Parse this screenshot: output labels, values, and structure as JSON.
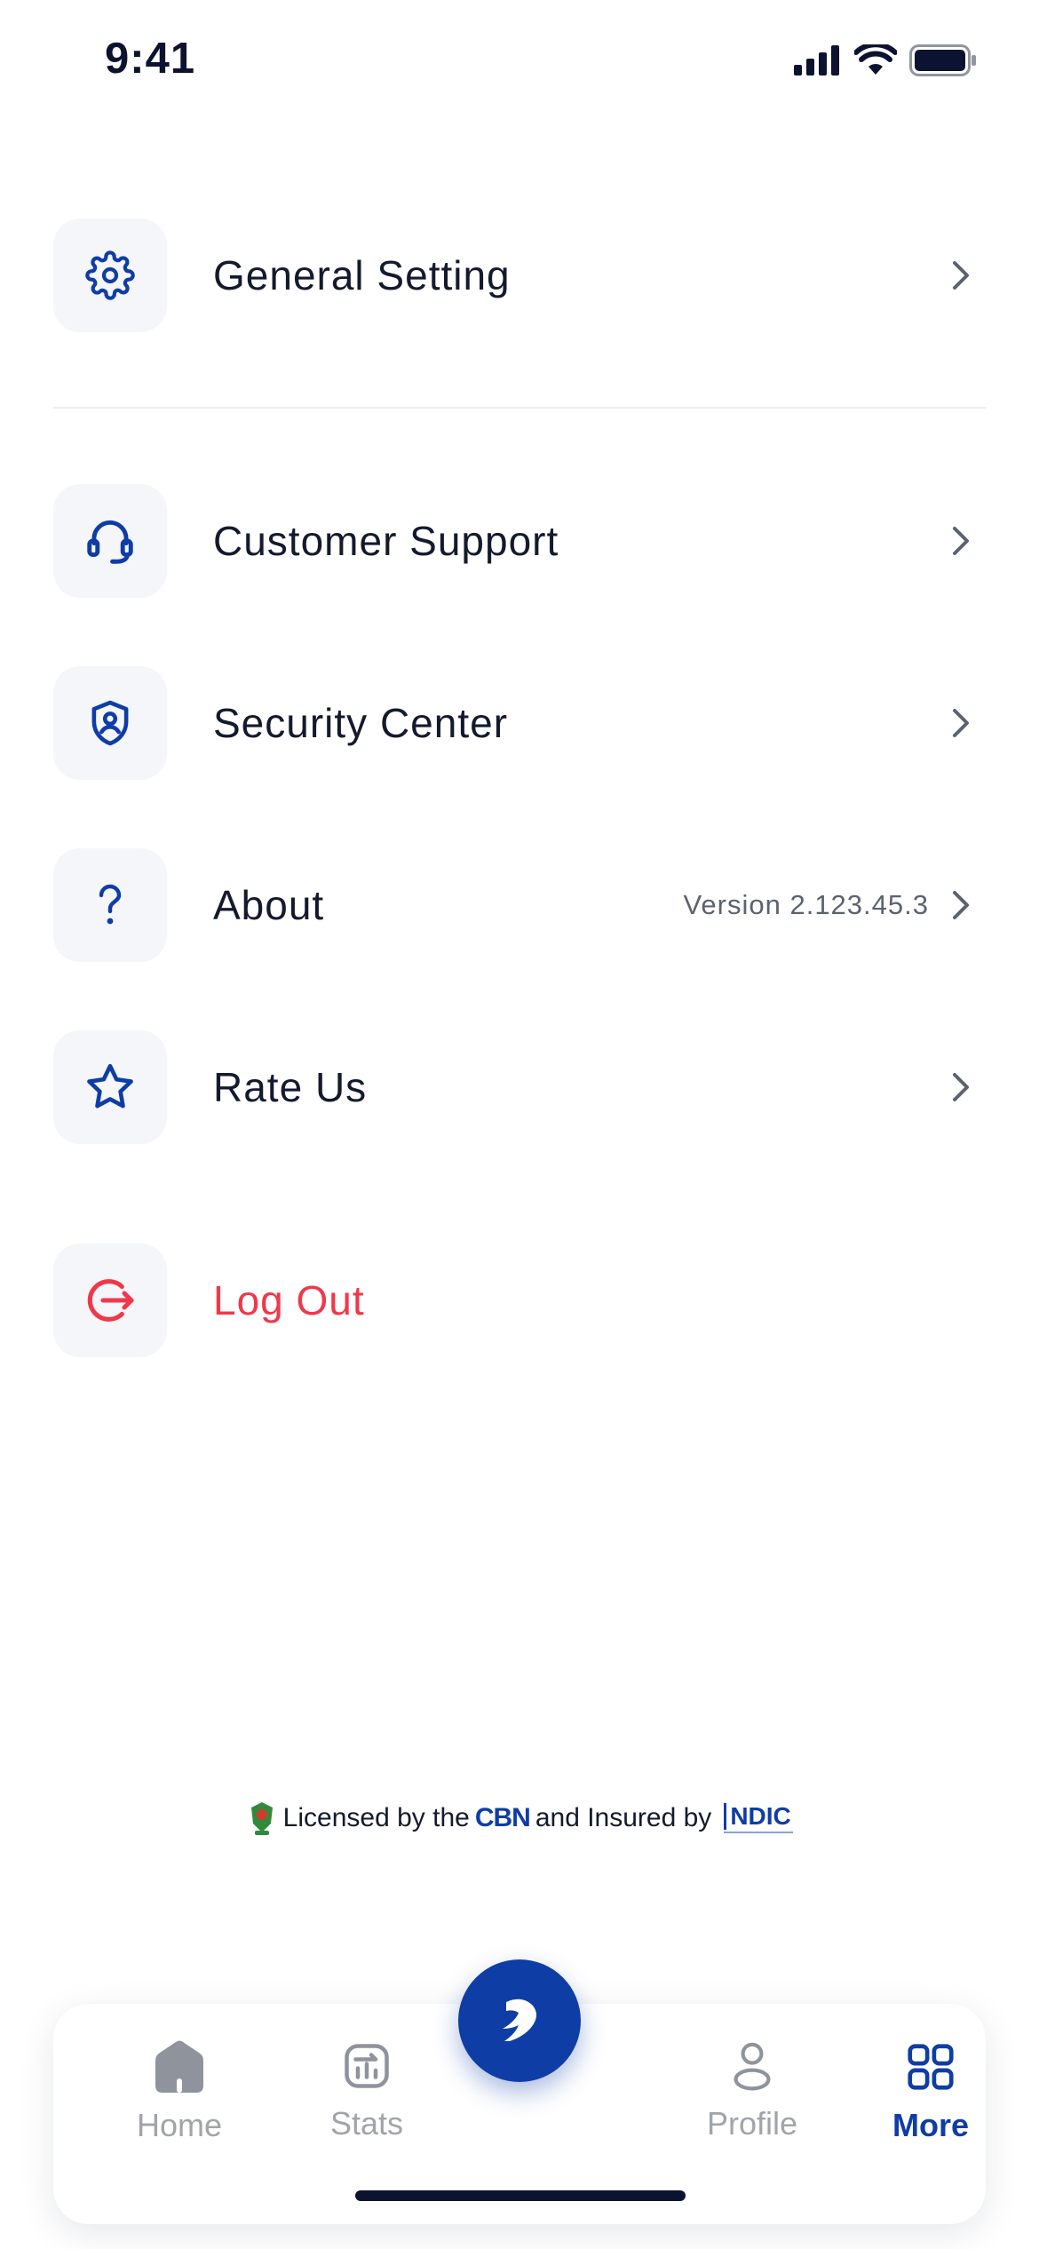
{
  "status_bar": {
    "time": "9:41"
  },
  "menu": {
    "general_setting": "General Setting",
    "customer_support": "Customer Support",
    "security_center": "Security Center",
    "about": "About",
    "about_version": "Version 2.123.45.3",
    "rate_us": "Rate Us",
    "log_out": "Log Out"
  },
  "footer": {
    "licensed_by": "Licensed by the",
    "cbn": "CBN",
    "insured_by": "and Insured by",
    "ndic": "NDIC"
  },
  "tabbar": {
    "home": "Home",
    "stats": "Stats",
    "profile": "Profile",
    "more": "More",
    "active_tab": "More"
  },
  "colors": {
    "accent": "#0f3da6",
    "danger": "#f0384a",
    "text": "#141a2e",
    "muted": "#a1a4ab"
  }
}
